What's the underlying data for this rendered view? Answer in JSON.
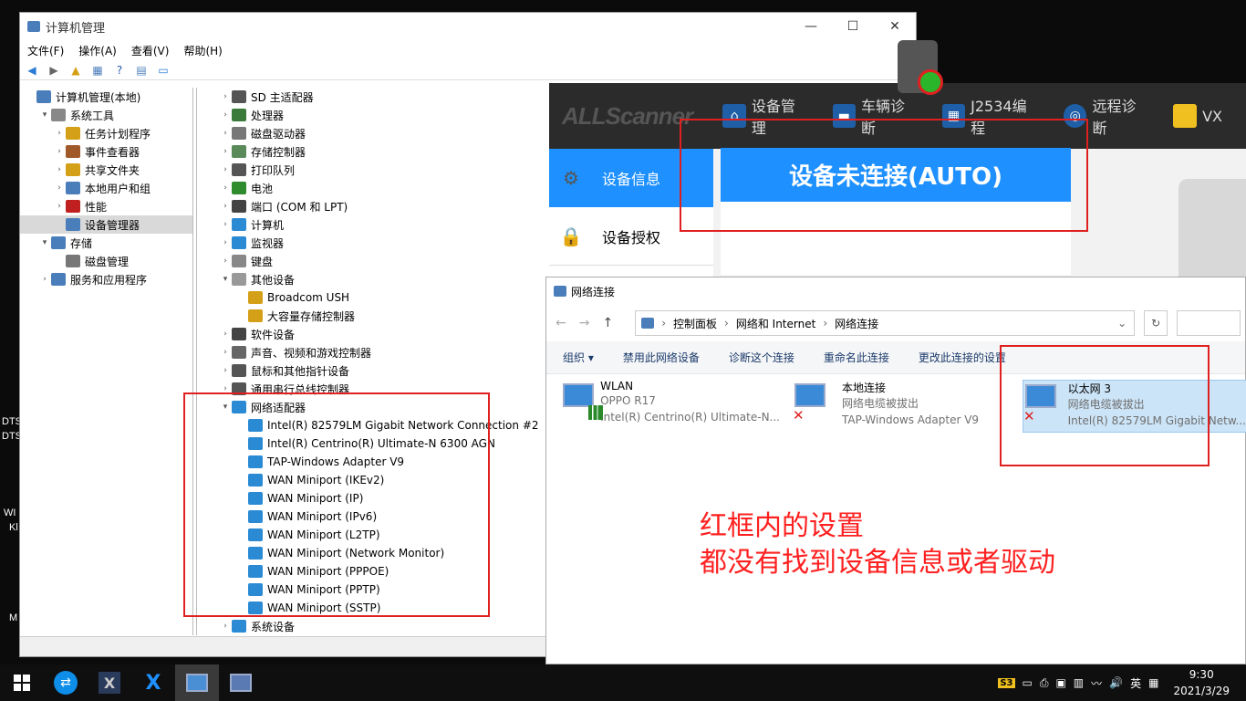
{
  "desktop": {
    "side_labels": [
      "DTS",
      "DTS",
      "WI",
      "Kl",
      "M"
    ]
  },
  "computer_management": {
    "title": "计算机管理",
    "controls": {
      "minimize": "—",
      "maximize": "☐",
      "close": "✕"
    },
    "menu": [
      "文件(F)",
      "操作(A)",
      "查看(V)",
      "帮助(H)"
    ],
    "tree": [
      {
        "label": "计算机管理(本地)",
        "indent": 0,
        "arrow": ""
      },
      {
        "label": "系统工具",
        "indent": 1,
        "arrow": "▾"
      },
      {
        "label": "任务计划程序",
        "indent": 2,
        "arrow": "›"
      },
      {
        "label": "事件查看器",
        "indent": 2,
        "arrow": "›"
      },
      {
        "label": "共享文件夹",
        "indent": 2,
        "arrow": "›"
      },
      {
        "label": "本地用户和组",
        "indent": 2,
        "arrow": "›"
      },
      {
        "label": "性能",
        "indent": 2,
        "arrow": "›"
      },
      {
        "label": "设备管理器",
        "indent": 2,
        "arrow": "",
        "selected": true
      },
      {
        "label": "存储",
        "indent": 1,
        "arrow": "▾"
      },
      {
        "label": "磁盘管理",
        "indent": 2,
        "arrow": ""
      },
      {
        "label": "服务和应用程序",
        "indent": 1,
        "arrow": "›"
      }
    ],
    "devices": [
      {
        "label": "SD 主适配器",
        "indent": 0,
        "arrow": "›",
        "color": "#555"
      },
      {
        "label": "处理器",
        "indent": 0,
        "arrow": "›",
        "color": "#3a7a3a"
      },
      {
        "label": "磁盘驱动器",
        "indent": 0,
        "arrow": "›",
        "color": "#777"
      },
      {
        "label": "存储控制器",
        "indent": 0,
        "arrow": "›",
        "color": "#5a8a5a"
      },
      {
        "label": "打印队列",
        "indent": 0,
        "arrow": "›",
        "color": "#555"
      },
      {
        "label": "电池",
        "indent": 0,
        "arrow": "›",
        "color": "#2e8b2e"
      },
      {
        "label": "端口 (COM 和 LPT)",
        "indent": 0,
        "arrow": "›",
        "color": "#444"
      },
      {
        "label": "计算机",
        "indent": 0,
        "arrow": "›",
        "color": "#2a8ad4"
      },
      {
        "label": "监视器",
        "indent": 0,
        "arrow": "›",
        "color": "#2a8ad4"
      },
      {
        "label": "键盘",
        "indent": 0,
        "arrow": "›",
        "color": "#888"
      },
      {
        "label": "其他设备",
        "indent": 0,
        "arrow": "▾",
        "color": "#999"
      },
      {
        "label": "Broadcom USH",
        "indent": 1,
        "arrow": "",
        "color": "#d4a017"
      },
      {
        "label": "大容量存储控制器",
        "indent": 1,
        "arrow": "",
        "color": "#d4a017"
      },
      {
        "label": "软件设备",
        "indent": 0,
        "arrow": "›",
        "color": "#444"
      },
      {
        "label": "声音、视频和游戏控制器",
        "indent": 0,
        "arrow": "›",
        "color": "#666"
      },
      {
        "label": "鼠标和其他指针设备",
        "indent": 0,
        "arrow": "›",
        "color": "#555"
      },
      {
        "label": "通用串行总线控制器",
        "indent": 0,
        "arrow": "›",
        "color": "#555"
      },
      {
        "label": "网络适配器",
        "indent": 0,
        "arrow": "▾",
        "color": "#2a8ad4"
      },
      {
        "label": "Intel(R) 82579LM Gigabit Network Connection #2",
        "indent": 1,
        "arrow": "",
        "color": "#2a8ad4"
      },
      {
        "label": "Intel(R) Centrino(R) Ultimate-N 6300 AGN",
        "indent": 1,
        "arrow": "",
        "color": "#2a8ad4"
      },
      {
        "label": "TAP-Windows Adapter V9",
        "indent": 1,
        "arrow": "",
        "color": "#2a8ad4"
      },
      {
        "label": "WAN Miniport (IKEv2)",
        "indent": 1,
        "arrow": "",
        "color": "#2a8ad4"
      },
      {
        "label": "WAN Miniport (IP)",
        "indent": 1,
        "arrow": "",
        "color": "#2a8ad4"
      },
      {
        "label": "WAN Miniport (IPv6)",
        "indent": 1,
        "arrow": "",
        "color": "#2a8ad4"
      },
      {
        "label": "WAN Miniport (L2TP)",
        "indent": 1,
        "arrow": "",
        "color": "#2a8ad4"
      },
      {
        "label": "WAN Miniport (Network Monitor)",
        "indent": 1,
        "arrow": "",
        "color": "#2a8ad4"
      },
      {
        "label": "WAN Miniport (PPPOE)",
        "indent": 1,
        "arrow": "",
        "color": "#2a8ad4"
      },
      {
        "label": "WAN Miniport (PPTP)",
        "indent": 1,
        "arrow": "",
        "color": "#2a8ad4"
      },
      {
        "label": "WAN Miniport (SSTP)",
        "indent": 1,
        "arrow": "",
        "color": "#2a8ad4"
      },
      {
        "label": "系统设备",
        "indent": 0,
        "arrow": "›",
        "color": "#2a8ad4"
      }
    ]
  },
  "allscanner": {
    "logo": "ALLScanner",
    "nav": [
      "设备管理",
      "车辆诊断",
      "J2534编程",
      "远程诊断",
      "VX"
    ],
    "side": [
      "设备信息",
      "设备授权"
    ],
    "status": "设备未连接(AUTO)"
  },
  "network": {
    "title": "网络连接",
    "breadcrumb": [
      "控制面板",
      "网络和 Internet",
      "网络连接"
    ],
    "commands": [
      "组织 ▾",
      "禁用此网络设备",
      "诊断这个连接",
      "重命名此连接",
      "更改此连接的设置"
    ],
    "connections": [
      {
        "name": "WLAN",
        "status": "OPPO R17",
        "adapter": "Intel(R) Centrino(R) Ultimate-N..."
      },
      {
        "name": "本地连接",
        "status": "网络电缆被拔出",
        "adapter": "TAP-Windows Adapter V9"
      },
      {
        "name": "以太网 3",
        "status": "网络电缆被拔出",
        "adapter": "Intel(R) 82579LM Gigabit Netw..."
      }
    ]
  },
  "annotation": {
    "line1": "红框内的设置",
    "line2": "都没有找到设备信息或者驱动"
  },
  "taskbar": {
    "tray_badge": "S3",
    "ime": "英",
    "time": "9:30",
    "date": "2021/3/29"
  },
  "colors": {
    "accent": "#1e90ff",
    "annotation_red": "#e02020",
    "selected_conn": "#cce4f7"
  }
}
